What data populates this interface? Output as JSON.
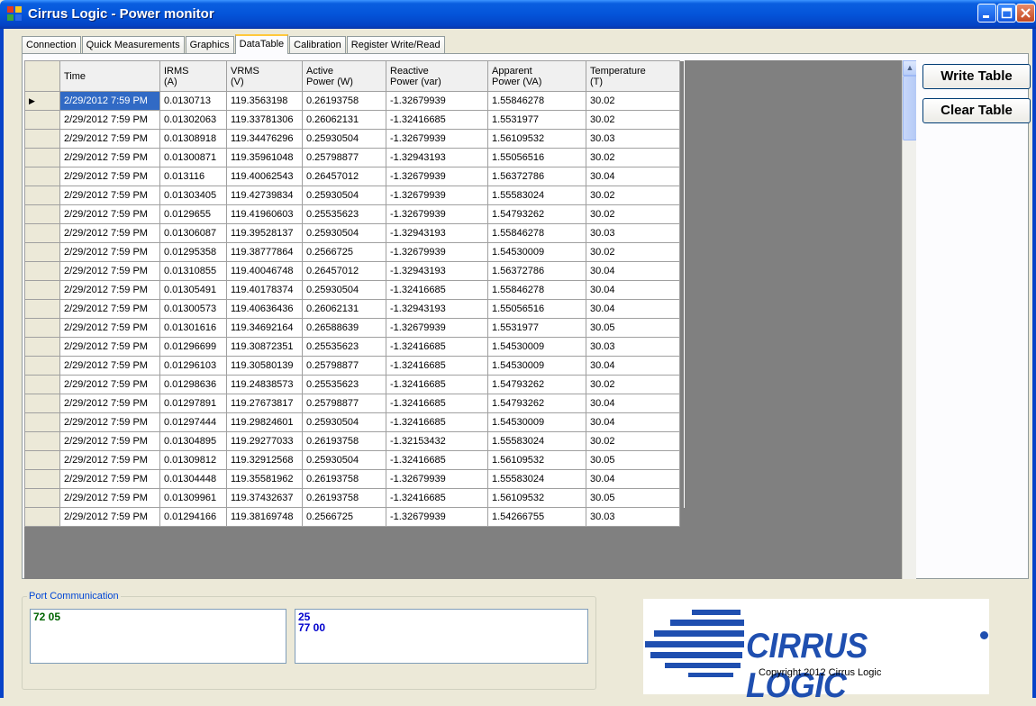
{
  "window": {
    "title": "Cirrus Logic - Power monitor"
  },
  "tabs": [
    {
      "label": "Connection"
    },
    {
      "label": "Quick Measurements"
    },
    {
      "label": "Graphics"
    },
    {
      "label": "DataTable",
      "active": true
    },
    {
      "label": "Calibration"
    },
    {
      "label": "Register Write/Read"
    }
  ],
  "table": {
    "columns": [
      "Time",
      "IRMS\n(A)",
      "VRMS\n(V)",
      "Active\nPower (W)",
      "Reactive\nPower (var)",
      "Apparent\nPower (VA)",
      "Temperature\n(T)"
    ],
    "rows": [
      [
        "2/29/2012 7:59 PM",
        "0.0130713",
        "119.3563198",
        "0.26193758",
        "-1.32679939",
        "1.55846278",
        "30.02"
      ],
      [
        "2/29/2012 7:59 PM",
        "0.01302063",
        "119.33781306",
        "0.26062131",
        "-1.32416685",
        "1.5531977",
        "30.02"
      ],
      [
        "2/29/2012 7:59 PM",
        "0.01308918",
        "119.34476296",
        "0.25930504",
        "-1.32679939",
        "1.56109532",
        "30.03"
      ],
      [
        "2/29/2012 7:59 PM",
        "0.01300871",
        "119.35961048",
        "0.25798877",
        "-1.32943193",
        "1.55056516",
        "30.02"
      ],
      [
        "2/29/2012 7:59 PM",
        "0.013116",
        "119.40062543",
        "0.26457012",
        "-1.32679939",
        "1.56372786",
        "30.04"
      ],
      [
        "2/29/2012 7:59 PM",
        "0.01303405",
        "119.42739834",
        "0.25930504",
        "-1.32679939",
        "1.55583024",
        "30.02"
      ],
      [
        "2/29/2012 7:59 PM",
        "0.0129655",
        "119.41960603",
        "0.25535623",
        "-1.32679939",
        "1.54793262",
        "30.02"
      ],
      [
        "2/29/2012 7:59 PM",
        "0.01306087",
        "119.39528137",
        "0.25930504",
        "-1.32943193",
        "1.55846278",
        "30.03"
      ],
      [
        "2/29/2012 7:59 PM",
        "0.01295358",
        "119.38777864",
        "0.2566725",
        "-1.32679939",
        "1.54530009",
        "30.02"
      ],
      [
        "2/29/2012 7:59 PM",
        "0.01310855",
        "119.40046748",
        "0.26457012",
        "-1.32943193",
        "1.56372786",
        "30.04"
      ],
      [
        "2/29/2012 7:59 PM",
        "0.01305491",
        "119.40178374",
        "0.25930504",
        "-1.32416685",
        "1.55846278",
        "30.04"
      ],
      [
        "2/29/2012 7:59 PM",
        "0.01300573",
        "119.40636436",
        "0.26062131",
        "-1.32943193",
        "1.55056516",
        "30.04"
      ],
      [
        "2/29/2012 7:59 PM",
        "0.01301616",
        "119.34692164",
        "0.26588639",
        "-1.32679939",
        "1.5531977",
        "30.05"
      ],
      [
        "2/29/2012 7:59 PM",
        "0.01296699",
        "119.30872351",
        "0.25535623",
        "-1.32416685",
        "1.54530009",
        "30.03"
      ],
      [
        "2/29/2012 7:59 PM",
        "0.01296103",
        "119.30580139",
        "0.25798877",
        "-1.32416685",
        "1.54530009",
        "30.04"
      ],
      [
        "2/29/2012 7:59 PM",
        "0.01298636",
        "119.24838573",
        "0.25535623",
        "-1.32416685",
        "1.54793262",
        "30.02"
      ],
      [
        "2/29/2012 7:59 PM",
        "0.01297891",
        "119.27673817",
        "0.25798877",
        "-1.32416685",
        "1.54793262",
        "30.04"
      ],
      [
        "2/29/2012 7:59 PM",
        "0.01297444",
        "119.29824601",
        "0.25930504",
        "-1.32416685",
        "1.54530009",
        "30.04"
      ],
      [
        "2/29/2012 7:59 PM",
        "0.01304895",
        "119.29277033",
        "0.26193758",
        "-1.32153432",
        "1.55583024",
        "30.02"
      ],
      [
        "2/29/2012 7:59 PM",
        "0.01309812",
        "119.32912568",
        "0.25930504",
        "-1.32416685",
        "1.56109532",
        "30.05"
      ],
      [
        "2/29/2012 7:59 PM",
        "0.01304448",
        "119.35581962",
        "0.26193758",
        "-1.32679939",
        "1.55583024",
        "30.04"
      ],
      [
        "2/29/2012 7:59 PM",
        "0.01309961",
        "119.37432637",
        "0.26193758",
        "-1.32416685",
        "1.56109532",
        "30.05"
      ],
      [
        "2/29/2012 7:59 PM",
        "0.01294166",
        "119.38169748",
        "0.2566725",
        "-1.32679939",
        "1.54266755",
        "30.03"
      ]
    ]
  },
  "buttons": {
    "write_table": "Write Table",
    "clear_table": "Clear Table"
  },
  "port": {
    "label": "Port Communication",
    "tx": "72 05",
    "rx": "25\n77 00"
  },
  "logo": {
    "text": "CIRRUS LOGIC"
  },
  "copyright": "Copyright 2012 Cirrus Logic",
  "colors": {
    "selection": "#316ac5",
    "logo_blue": "#1f4fb0",
    "title_bar": "#0454d9"
  }
}
